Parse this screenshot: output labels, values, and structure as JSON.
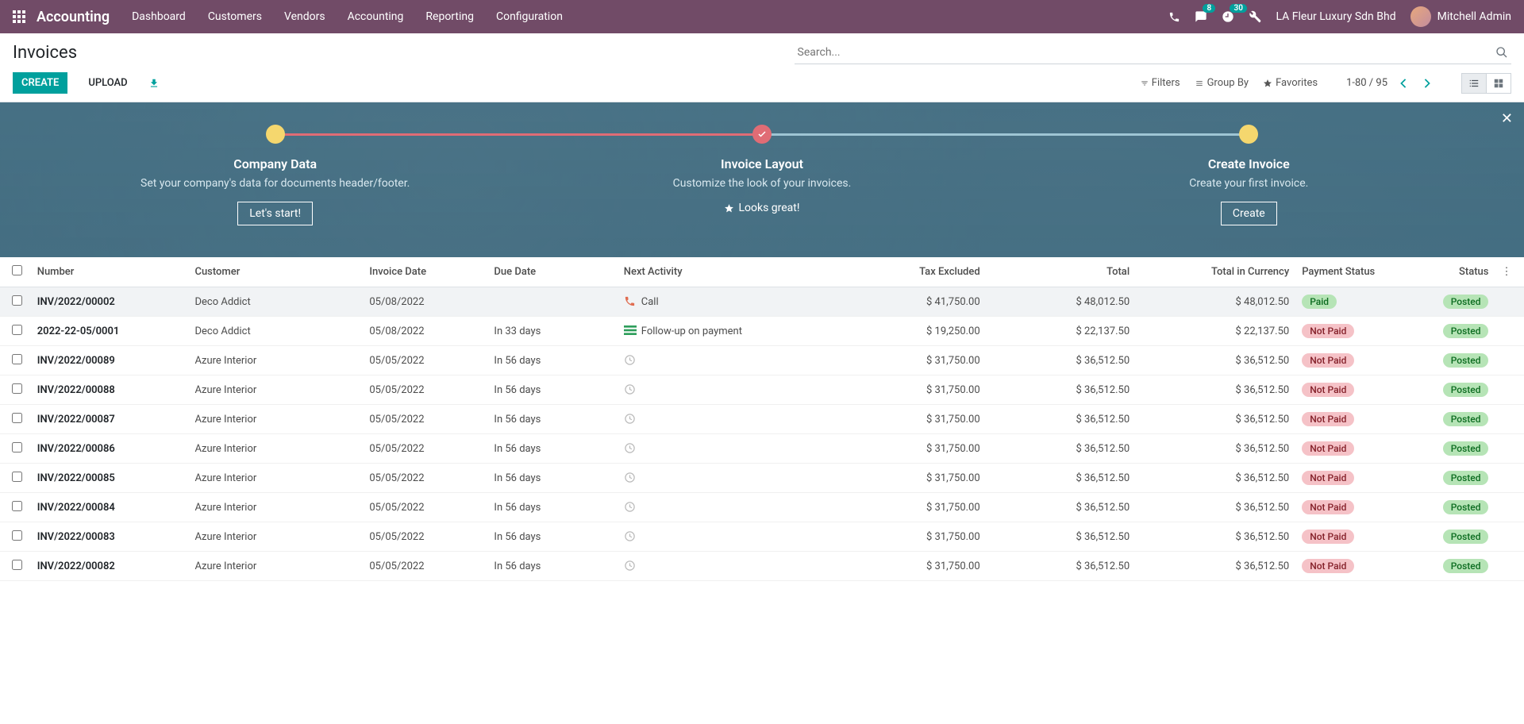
{
  "nav": {
    "brand": "Accounting",
    "items": [
      "Dashboard",
      "Customers",
      "Vendors",
      "Accounting",
      "Reporting",
      "Configuration"
    ],
    "msg_badge": "8",
    "clock_badge": "30",
    "company": "LA Fleur Luxury Sdn Bhd",
    "user": "Mitchell Admin"
  },
  "cp": {
    "title": "Invoices",
    "create": "CREATE",
    "upload": "UPLOAD",
    "search_ph": "Search...",
    "filters": "Filters",
    "groupby": "Group By",
    "favorites": "Favorites",
    "pager": "1-80 / 95"
  },
  "onb": {
    "steps": [
      {
        "title": "Company Data",
        "desc": "Set your company's data for documents header/footer.",
        "btn": "Let's start!"
      },
      {
        "title": "Invoice Layout",
        "desc": "Customize the look of your invoices.",
        "looks": "Looks great!"
      },
      {
        "title": "Create Invoice",
        "desc": "Create your first invoice.",
        "btn": "Create"
      }
    ]
  },
  "table": {
    "headers": {
      "number": "Number",
      "customer": "Customer",
      "invoice_date": "Invoice Date",
      "due_date": "Due Date",
      "next_activity": "Next Activity",
      "tax_excluded": "Tax Excluded",
      "total": "Total",
      "total_currency": "Total in Currency",
      "payment_status": "Payment Status",
      "status": "Status"
    },
    "rows": [
      {
        "number": "INV/2022/00002",
        "customer": "Deco Addict",
        "invoice_date": "05/08/2022",
        "due_date": "",
        "activity_icon": "phone",
        "activity": "Call",
        "tax_excluded": "$ 41,750.00",
        "total": "$ 48,012.50",
        "total_currency": "$ 48,012.50",
        "payment_status": "Paid",
        "status": "Posted",
        "hov": true
      },
      {
        "number": "2022-22-05/0001",
        "customer": "Deco Addict",
        "invoice_date": "05/08/2022",
        "due_date": "In 33 days",
        "activity_icon": "followup",
        "activity": "Follow-up on payment",
        "tax_excluded": "$ 19,250.00",
        "total": "$ 22,137.50",
        "total_currency": "$ 22,137.50",
        "payment_status": "Not Paid",
        "status": "Posted"
      },
      {
        "number": "INV/2022/00089",
        "customer": "Azure Interior",
        "invoice_date": "05/05/2022",
        "due_date": "In 56 days",
        "activity_icon": "clock",
        "activity": "",
        "tax_excluded": "$ 31,750.00",
        "total": "$ 36,512.50",
        "total_currency": "$ 36,512.50",
        "payment_status": "Not Paid",
        "status": "Posted"
      },
      {
        "number": "INV/2022/00088",
        "customer": "Azure Interior",
        "invoice_date": "05/05/2022",
        "due_date": "In 56 days",
        "activity_icon": "clock",
        "activity": "",
        "tax_excluded": "$ 31,750.00",
        "total": "$ 36,512.50",
        "total_currency": "$ 36,512.50",
        "payment_status": "Not Paid",
        "status": "Posted"
      },
      {
        "number": "INV/2022/00087",
        "customer": "Azure Interior",
        "invoice_date": "05/05/2022",
        "due_date": "In 56 days",
        "activity_icon": "clock",
        "activity": "",
        "tax_excluded": "$ 31,750.00",
        "total": "$ 36,512.50",
        "total_currency": "$ 36,512.50",
        "payment_status": "Not Paid",
        "status": "Posted"
      },
      {
        "number": "INV/2022/00086",
        "customer": "Azure Interior",
        "invoice_date": "05/05/2022",
        "due_date": "In 56 days",
        "activity_icon": "clock",
        "activity": "",
        "tax_excluded": "$ 31,750.00",
        "total": "$ 36,512.50",
        "total_currency": "$ 36,512.50",
        "payment_status": "Not Paid",
        "status": "Posted"
      },
      {
        "number": "INV/2022/00085",
        "customer": "Azure Interior",
        "invoice_date": "05/05/2022",
        "due_date": "In 56 days",
        "activity_icon": "clock",
        "activity": "",
        "tax_excluded": "$ 31,750.00",
        "total": "$ 36,512.50",
        "total_currency": "$ 36,512.50",
        "payment_status": "Not Paid",
        "status": "Posted"
      },
      {
        "number": "INV/2022/00084",
        "customer": "Azure Interior",
        "invoice_date": "05/05/2022",
        "due_date": "In 56 days",
        "activity_icon": "clock",
        "activity": "",
        "tax_excluded": "$ 31,750.00",
        "total": "$ 36,512.50",
        "total_currency": "$ 36,512.50",
        "payment_status": "Not Paid",
        "status": "Posted"
      },
      {
        "number": "INV/2022/00083",
        "customer": "Azure Interior",
        "invoice_date": "05/05/2022",
        "due_date": "In 56 days",
        "activity_icon": "clock",
        "activity": "",
        "tax_excluded": "$ 31,750.00",
        "total": "$ 36,512.50",
        "total_currency": "$ 36,512.50",
        "payment_status": "Not Paid",
        "status": "Posted"
      },
      {
        "number": "INV/2022/00082",
        "customer": "Azure Interior",
        "invoice_date": "05/05/2022",
        "due_date": "In 56 days",
        "activity_icon": "clock",
        "activity": "",
        "tax_excluded": "$ 31,750.00",
        "total": "$ 36,512.50",
        "total_currency": "$ 36,512.50",
        "payment_status": "Not Paid",
        "status": "Posted"
      }
    ]
  }
}
